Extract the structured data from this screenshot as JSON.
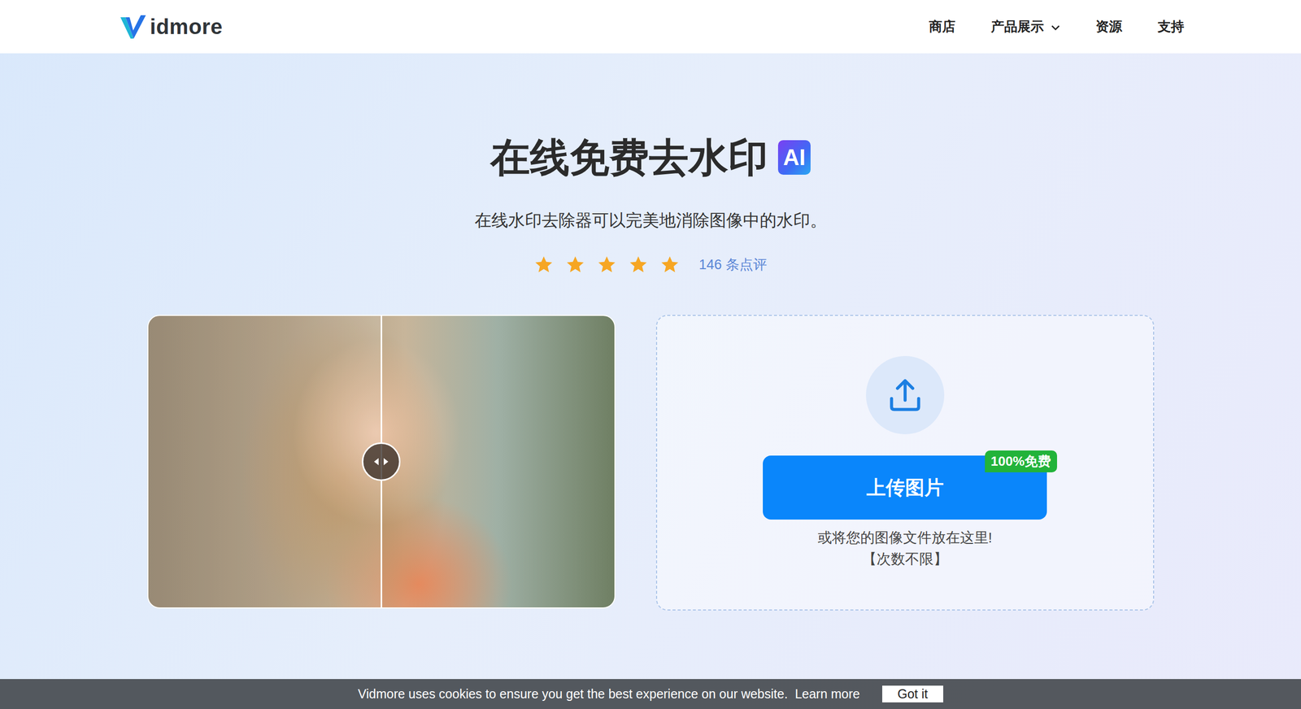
{
  "header": {
    "logo": {
      "text": "idmore"
    },
    "nav": [
      {
        "label": "商店",
        "has_dropdown": false
      },
      {
        "label": "产品展示",
        "has_dropdown": true
      },
      {
        "label": "资源",
        "has_dropdown": false
      },
      {
        "label": "支持",
        "has_dropdown": false
      }
    ]
  },
  "hero": {
    "title": "在线免费去水印",
    "badge": "AI",
    "subtitle": "在线水印去除器可以完美地消除图像中的水印。",
    "rating": {
      "stars": 5,
      "reviews": "146 条点评"
    }
  },
  "preview": {
    "level": 0.5
  },
  "upload": {
    "button": "上传图片",
    "badge": "100%免费",
    "hint": "或将您的图像文件放在这里!",
    "limit": "【次数不限】"
  },
  "cookie_bar": {
    "text": "Vidmore uses cookies to ensure you get the best experience on our website.",
    "link": "Learn more",
    "button": "Got it"
  }
}
